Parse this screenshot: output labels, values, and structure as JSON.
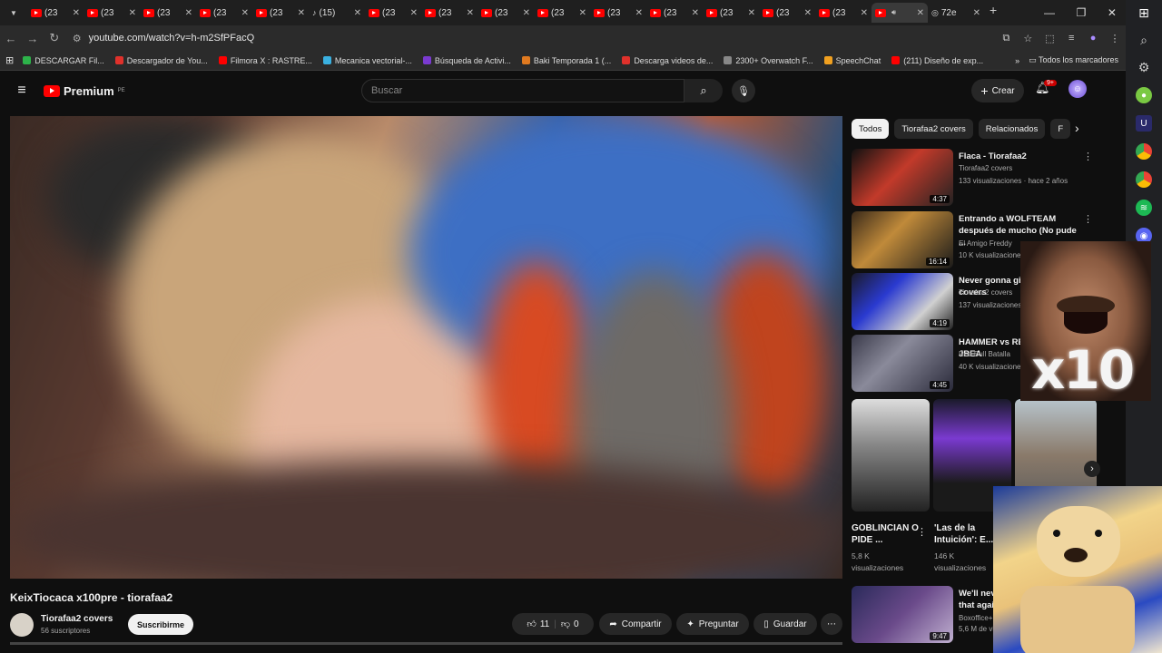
{
  "browser": {
    "tabs": [
      {
        "label": "(23"
      },
      {
        "label": "(23"
      },
      {
        "label": "(23"
      },
      {
        "label": "(23"
      },
      {
        "label": "(23"
      },
      {
        "label": "(15)"
      },
      {
        "label": "(23"
      },
      {
        "label": "(23"
      },
      {
        "label": "(23"
      },
      {
        "label": "(23"
      },
      {
        "label": "(23"
      },
      {
        "label": "(23"
      },
      {
        "label": "(23"
      },
      {
        "label": "(23"
      },
      {
        "label": "(23"
      },
      {
        "label": ""
      },
      {
        "label": "72e"
      }
    ],
    "url": "youtube.com/watch?v=h-m2SfPFacQ",
    "bookmarks": [
      {
        "label": "DESCARGAR Fil...",
        "color": "#2db34a"
      },
      {
        "label": "Descargador de You...",
        "color": "#e0312b"
      },
      {
        "label": "Filmora X : RASTRE...",
        "color": "#ff0000"
      },
      {
        "label": "Mecanica vectorial-...",
        "color": "#3ab0e0"
      },
      {
        "label": "Búsqueda de Activi...",
        "color": "#7a3ad0"
      },
      {
        "label": "Baki Temporada 1 (...",
        "color": "#e07a20"
      },
      {
        "label": "Descarga videos de...",
        "color": "#e0312b"
      },
      {
        "label": "2300+ Overwatch F...",
        "color": "#888888"
      },
      {
        "label": "SpeechChat",
        "color": "#f0a020"
      },
      {
        "label": "(211) Diseño de exp...",
        "color": "#ff0000"
      }
    ],
    "all_bookmarks": "Todos los marcadores"
  },
  "header": {
    "logo_text": "Premium",
    "region": "PE",
    "search_placeholder": "Buscar",
    "create_label": "Crear",
    "notif_count": "9+"
  },
  "video": {
    "title": "KeixTiocaca x100pre - tiorafaa2",
    "channel": "Tiorafaa2 covers",
    "subscribers": "56 suscriptores",
    "subscribe_label": "Suscribirme",
    "likes": "11",
    "dislikes": "0",
    "share_label": "Compartir",
    "ask_label": "Preguntar",
    "save_label": "Guardar"
  },
  "chips": [
    "Todos",
    "Tiorafaa2 covers",
    "Relacionados",
    "F"
  ],
  "recommendations": [
    {
      "title": "Flaca - Tiorafaa2",
      "channel": "Tiorafaa2 covers",
      "meta": "133 visualizaciones · hace 2 años",
      "duration": "4:37"
    },
    {
      "title": "Entrando a WOLFTEAM después de mucho (No pude ...",
      "channel": "El Amigo Freddy",
      "meta": "10 K visualizaciones",
      "duration": "16:14"
    },
    {
      "title": "Never gonna give Tiorafaa2 covers",
      "channel": "Tiorafaa2 covers",
      "meta": "137 visualizaciones",
      "duration": "4:19"
    },
    {
      "title": "HAMMER vs REV ROLLING de JBEA",
      "channel": "Red Bull Batalla",
      "meta": "40 K visualizaciones · ha",
      "duration": "4:45"
    }
  ],
  "shorts": [
    {
      "title": "GOBLINCIAN O PIDE ...",
      "views": "5,8 K",
      "views_label": "visualizaciones"
    },
    {
      "title": "'Las de la Intuición': E...",
      "views": "146 K",
      "views_label": "visualizaciones"
    }
  ],
  "rec_last": {
    "title": "We'll neve that again",
    "channel": "Boxoffice+",
    "meta": "5,6 M de vi",
    "duration": "9:47"
  },
  "overlay_text": "x10"
}
